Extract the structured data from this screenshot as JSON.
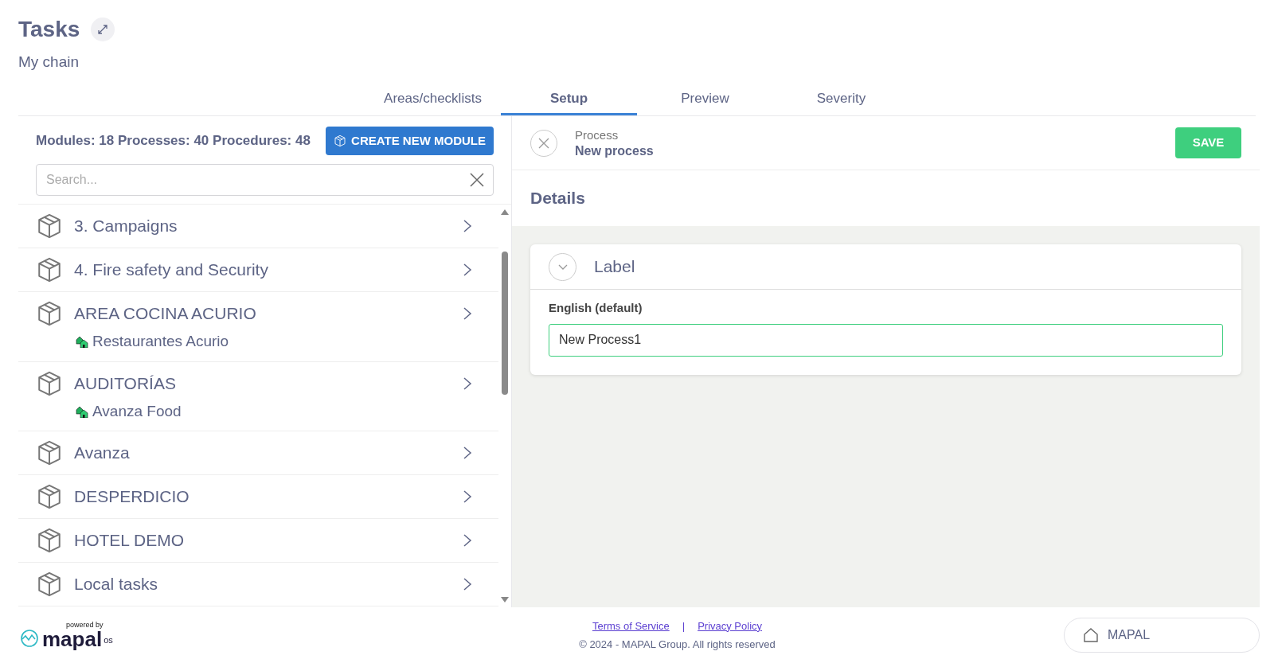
{
  "header": {
    "title": "Tasks",
    "subtitle": "My chain"
  },
  "tabs": [
    {
      "label": "Areas/checklists",
      "selected": false
    },
    {
      "label": "Setup",
      "selected": true
    },
    {
      "label": "Preview",
      "selected": false
    },
    {
      "label": "Severity",
      "selected": false
    }
  ],
  "modules_panel": {
    "summary": "Modules: 18 Processes: 40 Procedures: 48",
    "create_button": "CREATE NEW MODULE",
    "search": {
      "placeholder": "Search..."
    },
    "modules": [
      {
        "name": "3. Campaigns"
      },
      {
        "name": "4. Fire safety and Security"
      },
      {
        "name": "AREA COCINA ACURIO",
        "location": "Restaurantes Acurio"
      },
      {
        "name": "AUDITORÍAS",
        "location": "Avanza Food"
      },
      {
        "name": "Avanza"
      },
      {
        "name": "DESPERDICIO"
      },
      {
        "name": "HOTEL DEMO"
      },
      {
        "name": "Local tasks"
      }
    ]
  },
  "process_panel": {
    "kind_label": "Process",
    "name": "New process",
    "save_button": "SAVE",
    "section_title": "Details",
    "label_card": {
      "title": "Label",
      "expanded": true,
      "field_label": "English (default)",
      "value": "New Process1"
    }
  },
  "footer": {
    "powered_by": "powered by",
    "brand": "mapal",
    "brand_suffix": "os",
    "links": [
      "Terms of Service",
      "Privacy Policy"
    ],
    "separator": "|",
    "copyright": "© 2024 - MAPAL Group. All rights reserved",
    "account_button": "MAPAL"
  }
}
